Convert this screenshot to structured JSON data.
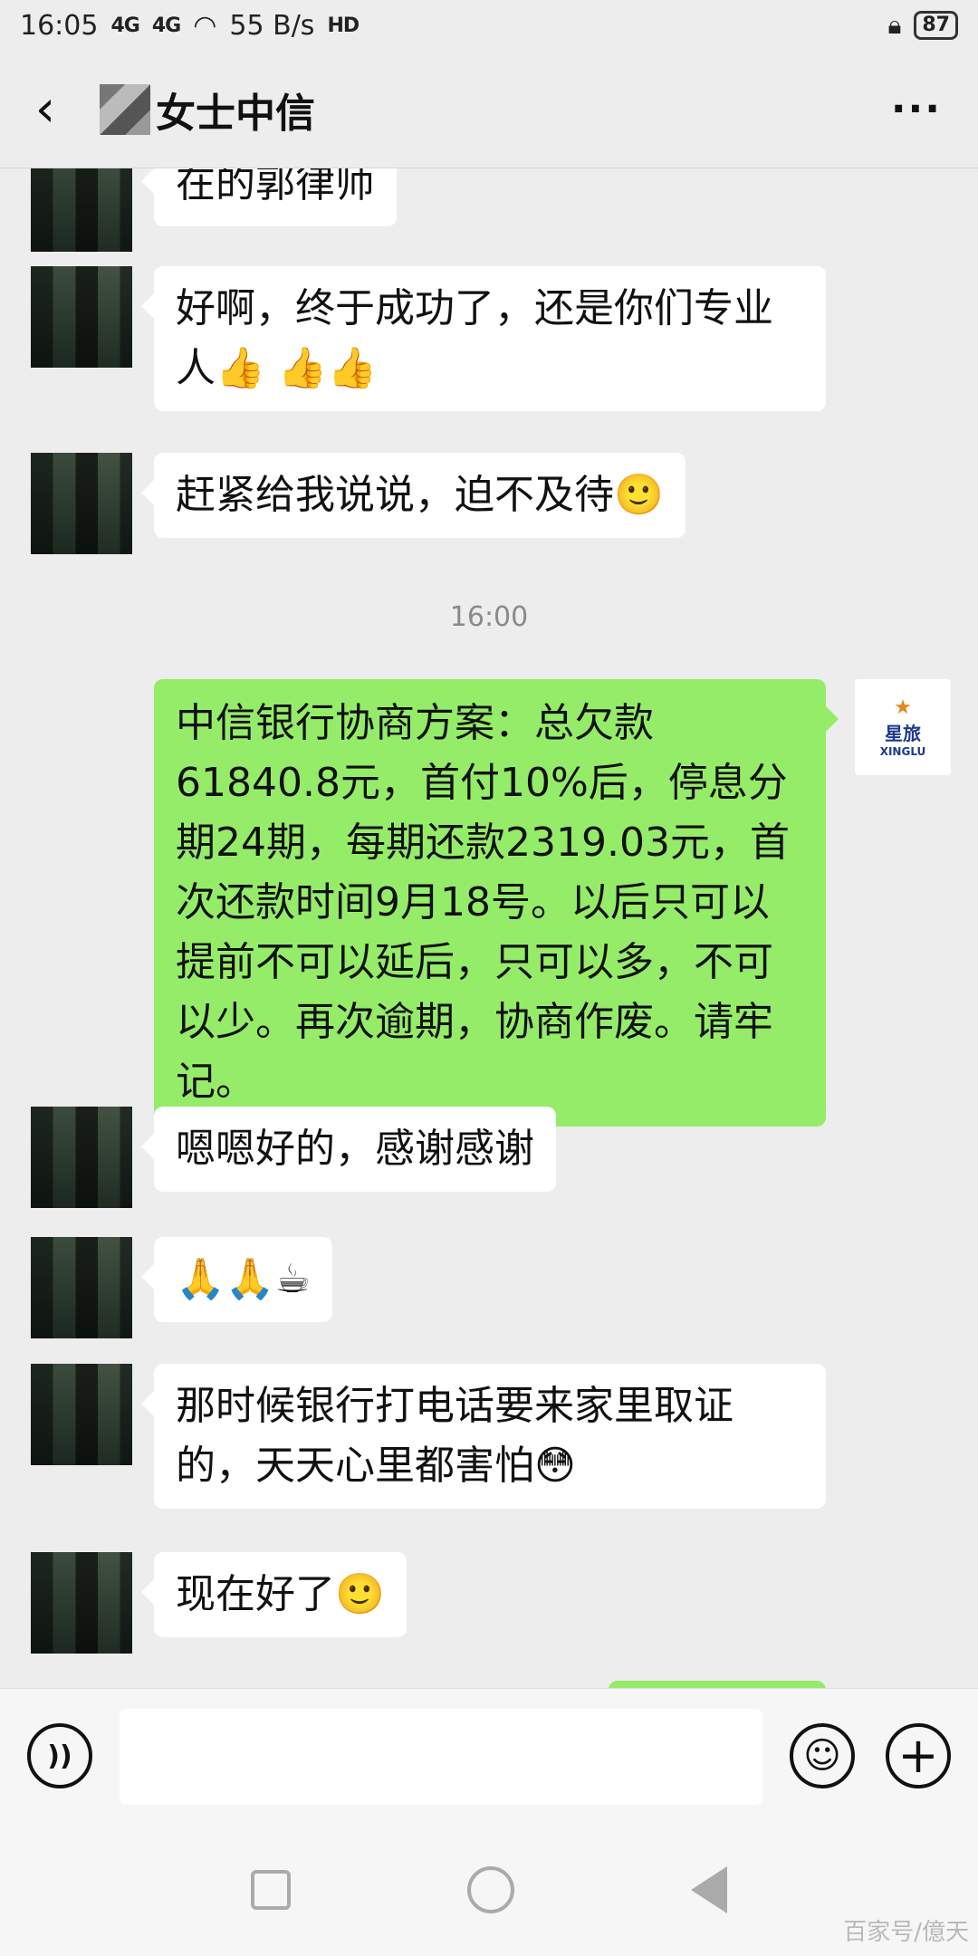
{
  "status_bar": {
    "time": "16:05",
    "signal1": "4G",
    "signal2": "4G",
    "net_speed": "55 B/s",
    "hd": "HD",
    "battery": "87"
  },
  "header": {
    "back_icon": "chevron-left-icon",
    "title": "女士中信",
    "more_icon": "more-icon"
  },
  "messages": [
    {
      "side": "left",
      "text": "在的郭律师"
    },
    {
      "side": "left",
      "text": "好啊，终于成功了，还是你们专业人👍 👍👍"
    },
    {
      "side": "left",
      "text": "赶紧给我说说，迫不及待🙂"
    },
    {
      "type": "time",
      "text": "16:00"
    },
    {
      "side": "right",
      "text": " 中信银行协商方案：总欠款61840.8元，首付10%后，停息分期24期，每期还款2319.03元，首次还款时间9月18号。以后只可以提前不可以延后，只可以多，不可以少。再次逾期，协商作废。请牢记。"
    },
    {
      "side": "left",
      "text": "嗯嗯好的，感谢感谢"
    },
    {
      "side": "left",
      "text": "🙏🙏☕"
    },
    {
      "side": "left",
      "text": "那时候银行打电话要来家里取证的，天天心里都害怕😳"
    },
    {
      "side": "left",
      "text": "现在好了🙂"
    }
  ],
  "self_avatar": {
    "brand": "星旅",
    "sub": "XINGLU"
  },
  "input_bar": {
    "voice_icon": "voice-icon",
    "input_value": "",
    "emoji_icon": "emoji-icon",
    "plus_icon": "plus-icon"
  },
  "watermark": "百家号/億天"
}
